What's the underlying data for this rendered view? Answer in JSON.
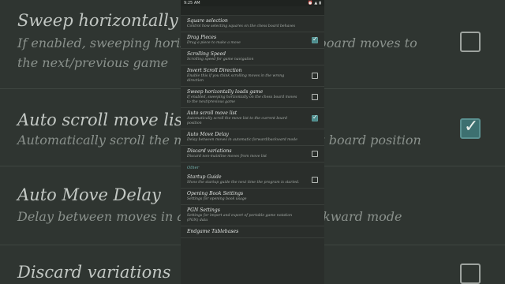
{
  "status": {
    "time": "9:25 AM",
    "icons": [
      "⏰",
      "▲",
      "▮"
    ]
  },
  "background": {
    "rows": [
      {
        "title": "Sweep horizontally loads game",
        "subtitle1": "If enabled, sweeping horizontally on the chess board moves to",
        "subtitle2": "the next/previous game",
        "checked": false
      },
      {
        "title": "Auto scroll move list",
        "subtitle1": "Automatically scroll the move list to the current board position",
        "checked": true
      },
      {
        "title": "Auto Move Delay",
        "subtitle1": "Delay between moves in automatic forward/backward mode"
      },
      {
        "title": "Discard variations"
      }
    ]
  },
  "settings": {
    "items": [
      {
        "id": "square-selection",
        "title": "Square selection",
        "subtitle": "Control how selecting squares on the chess board behaves",
        "checkbox": null
      },
      {
        "id": "drag-pieces",
        "title": "Drag Pieces",
        "subtitle": "Drag a piece to make a move",
        "checkbox": true
      },
      {
        "id": "scrolling-speed",
        "title": "Scrolling Speed",
        "subtitle": "Scrolling speed for game navigation",
        "checkbox": null
      },
      {
        "id": "invert-scroll",
        "title": "Invert Scroll Direction",
        "subtitle": "Enable this if you think scrolling moves in the wrong direction",
        "checkbox": false
      },
      {
        "id": "sweep-horizontally",
        "title": "Sweep horizontally loads game",
        "subtitle": "If enabled, sweeping horizontally on the chess board moves to the next/previous game",
        "checkbox": false
      },
      {
        "id": "auto-scroll",
        "title": "Auto scroll move list",
        "subtitle": "Automatically scroll the move list to the current board position",
        "checkbox": true
      },
      {
        "id": "auto-move-delay",
        "title": "Auto Move Delay",
        "subtitle": "Delay between moves in automatic forward/backward mode",
        "checkbox": null
      },
      {
        "id": "discard-variations",
        "title": "Discard variations",
        "subtitle": "Discard non-mainline moves from move list",
        "checkbox": false
      }
    ],
    "other_header": "Other",
    "other_items": [
      {
        "id": "startup-guide",
        "title": "Startup Guide",
        "subtitle": "Show the startup guide the next time the program is started.",
        "checkbox": false
      },
      {
        "id": "opening-book",
        "title": "Opening Book Settings",
        "subtitle": "Settings for opening book usage",
        "checkbox": null
      },
      {
        "id": "pgn-settings",
        "title": "PGN Settings",
        "subtitle": "Settings for import and export of portable game notation (PGN) data",
        "checkbox": null
      },
      {
        "id": "endgame-tablebases",
        "title": "Endgame Tablebases",
        "subtitle": "",
        "checkbox": null
      }
    ]
  }
}
